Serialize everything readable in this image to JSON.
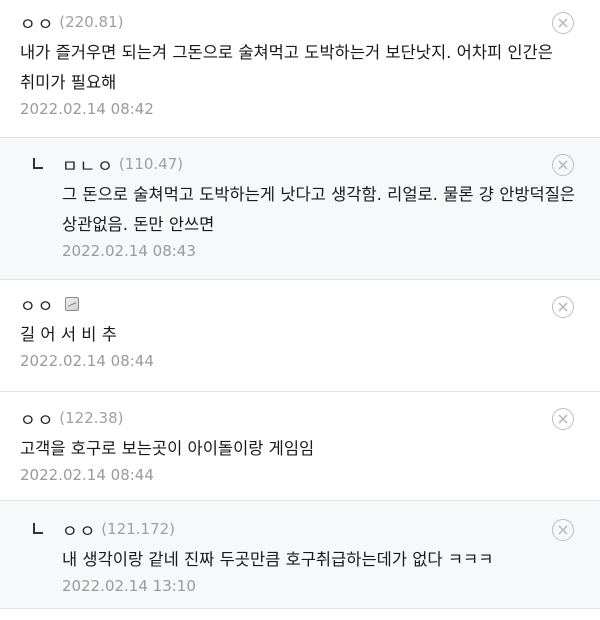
{
  "comments": [
    {
      "author": "ㅇㅇ",
      "ip": "(220.81)",
      "body": "내가 즐거우면 되는겨 그돈으로 술쳐먹고 도박하는거 보단낫지. 어차피 인간은 취미가 필요해",
      "date": "2022.02.14 08:42",
      "close_icon": "close-circle-icon"
    },
    {
      "author": "ㅁㄴㅇ",
      "ip": "(110.47)",
      "body": "그 돈으로 술쳐먹고 도박하는게 낫다고 생각함. 리얼로. 물론 걍 안방덕질은 상관없음. 돈만 안쓰면",
      "date": "2022.02.14 08:43",
      "reply_icon": "reply-arrow-icon",
      "close_icon": "close-circle-icon"
    },
    {
      "author": "ㅇㅇ",
      "ip": "",
      "badge_icon": "image-attachment-icon",
      "body": "길 어 서 비 추",
      "date": "2022.02.14 08:44",
      "close_icon": "close-circle-icon"
    },
    {
      "author": "ㅇㅇ",
      "ip": "(122.38)",
      "body": "고객을 호구로 보는곳이 아이돌이랑 게임임",
      "date": "2022.02.14 08:44",
      "close_icon": "close-circle-icon"
    },
    {
      "author": "ㅇㅇ",
      "ip": "(121.172)",
      "body": "내 생각이랑 같네 진짜 두곳만큼 호구취급하는데가 없다 ㅋㅋㅋ",
      "date": "2022.02.14 13:10",
      "reply_icon": "reply-arrow-icon",
      "close_icon": "close-circle-icon"
    }
  ]
}
